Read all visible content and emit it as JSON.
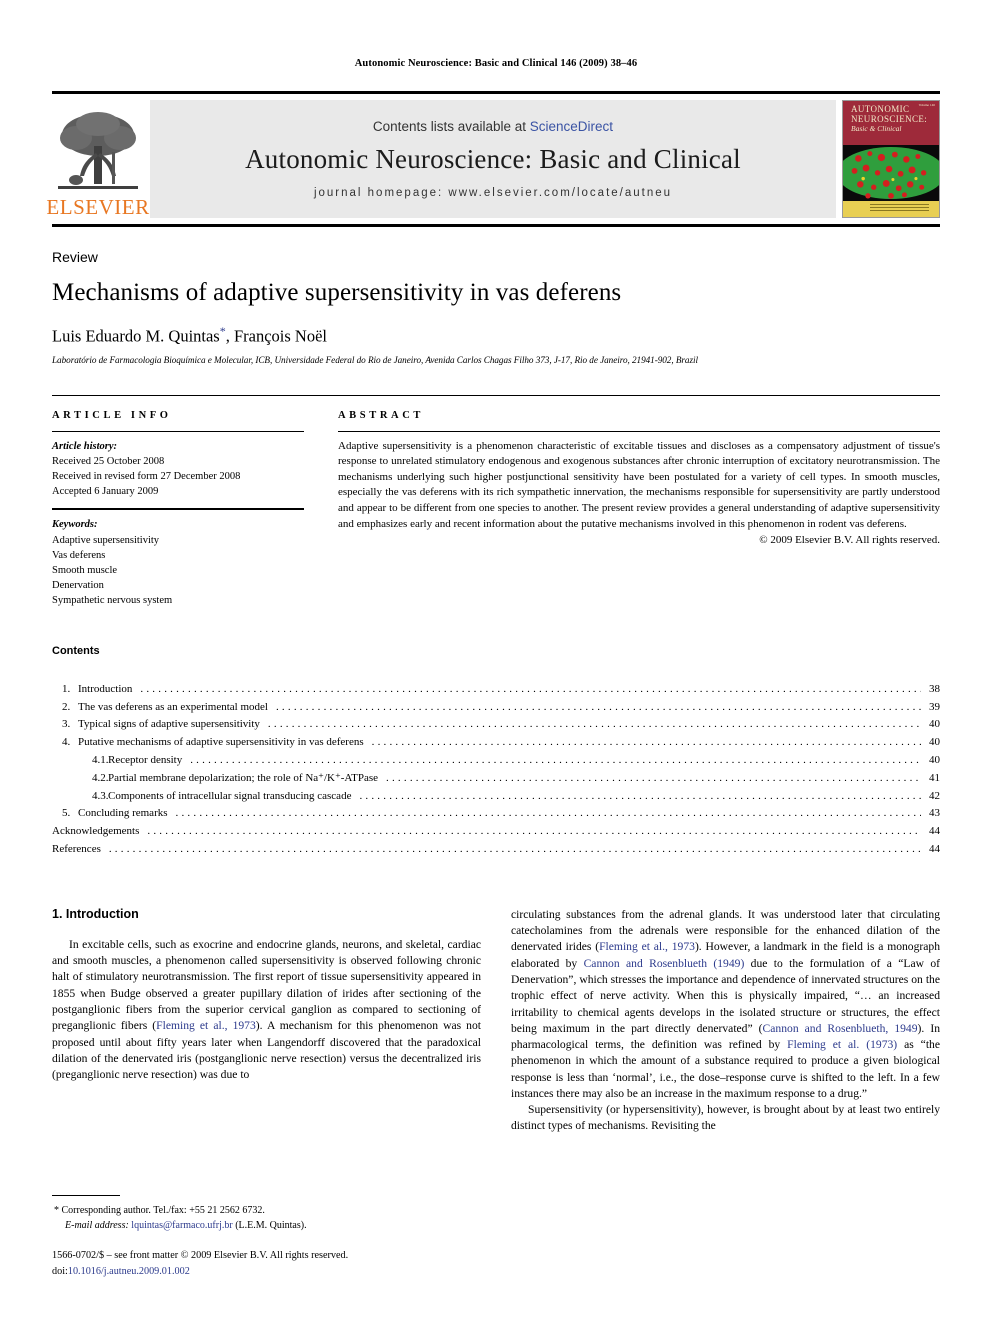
{
  "running_head": "Autonomic Neuroscience: Basic and Clinical 146 (2009) 38–46",
  "masthead": {
    "contents_available": "Contents lists available at",
    "sciencedirect": "ScienceDirect",
    "journal_title": "Autonomic Neuroscience: Basic and Clinical",
    "homepage": "journal homepage: www.elsevier.com/locate/autneu",
    "publisher": "ELSEVIER",
    "cover": {
      "line1": "AUTONOMIC",
      "line2": "NEUROSCIENCE:",
      "line3": "Basic & Clinical",
      "volume": "Volume 146"
    }
  },
  "article": {
    "type": "Review",
    "title": "Mechanisms of adaptive supersensitivity in vas deferens",
    "authors": "Luis Eduardo M. Quintas",
    "corresponding_mark": "*",
    "authors_rest": ", François Noël",
    "affiliation": "Laboratório de Farmacologia Bioquímica e Molecular, ICB, Universidade Federal do Rio de Janeiro, Avenida Carlos Chagas Filho 373, J-17, Rio de Janeiro, 21941-902, Brazil"
  },
  "article_info": {
    "heading": "ARTICLE INFO",
    "history_label": "Article history:",
    "history": [
      "Received 25 October 2008",
      "Received in revised form 27 December 2008",
      "Accepted 6 January 2009"
    ],
    "keywords_label": "Keywords:",
    "keywords": [
      "Adaptive supersensitivity",
      "Vas deferens",
      "Smooth muscle",
      "Denervation",
      "Sympathetic nervous system"
    ]
  },
  "abstract": {
    "heading": "ABSTRACT",
    "text": "Adaptive supersensitivity is a phenomenon characteristic of excitable tissues and discloses as a compensatory adjustment of tissue's response to unrelated stimulatory endogenous and exogenous substances after chronic interruption of excitatory neurotransmission. The mechanisms underlying such higher postjunctional sensitivity have been postulated for a variety of cell types. In smooth muscles, especially the vas deferens with its rich sympathetic innervation, the mechanisms responsible for supersensitivity are partly understood and appear to be different from one species to another. The present review provides a general understanding of adaptive supersensitivity and emphasizes early and recent information about the putative mechanisms involved in this phenomenon in rodent vas deferens.",
    "copyright": "© 2009 Elsevier B.V. All rights reserved."
  },
  "contents": {
    "heading": "Contents",
    "items": [
      {
        "num": "1.",
        "level": 0,
        "label": "Introduction",
        "page": "38"
      },
      {
        "num": "2.",
        "level": 0,
        "label": "The vas deferens as an experimental model",
        "page": "39"
      },
      {
        "num": "3.",
        "level": 0,
        "label": "Typical signs of adaptive supersensitivity",
        "page": "40"
      },
      {
        "num": "4.",
        "level": 0,
        "label": "Putative mechanisms of adaptive supersensitivity in vas deferens",
        "page": "40"
      },
      {
        "num": "4.1.",
        "level": 1,
        "label": "Receptor density",
        "page": "40"
      },
      {
        "num": "4.2.",
        "level": 1,
        "label": "Partial membrane depolarization; the role of Na⁺/K⁺-ATPase",
        "page": "41"
      },
      {
        "num": "4.3.",
        "level": 1,
        "label": "Components of intracellular signal transducing cascade",
        "page": "42"
      },
      {
        "num": "5.",
        "level": 0,
        "label": "Concluding remarks",
        "page": "43"
      },
      {
        "num": "",
        "level": 2,
        "label": "Acknowledgements",
        "page": "44"
      },
      {
        "num": "",
        "level": 2,
        "label": "References",
        "page": "44"
      }
    ]
  },
  "introduction": {
    "heading": "1. Introduction",
    "left_p1_a": "In excitable cells, such as exocrine and endocrine glands, neurons, and skeletal, cardiac and smooth muscles, a phenomenon called supersensitivity is observed following chronic halt of stimulatory neurotransmission. The first report of tissue supersensitivity appeared in 1855 when Budge observed a greater pupillary dilation of irides after sectioning of the postganglionic fibers from the superior cervical ganglion as compared to sectioning of preganglionic fibers (",
    "left_ref1": "Fleming et al., 1973",
    "left_p1_b": "). A mechanism for this phenomenon was not proposed until about fifty years later when Langendorff discovered that the paradoxical dilation of the denervated iris (postganglionic nerve resection) versus the decentralized iris (preganglionic nerve resection) was due to",
    "right_p1_a": "circulating substances from the adrenal glands. It was understood later that circulating catecholamines from the adrenals were responsible for the enhanced dilation of the denervated irides (",
    "right_ref1": "Fleming et al., 1973",
    "right_p1_b": "). However, a landmark in the field is a monograph elaborated by ",
    "right_ref2": "Cannon and Rosenblueth (1949)",
    "right_p1_c": " due to the formulation of a “Law of Denervation”, which stresses the importance and dependence of innervated structures on the trophic effect of nerve activity. When this is physically impaired, “… an increased irritability to chemical agents develops in the isolated structure or structures, the effect being maximum in the part directly denervated” (",
    "right_ref3": "Cannon and Rosenblueth, 1949",
    "right_p1_d": "). In pharmacological terms, the definition was refined by ",
    "right_ref4": "Fleming et al. (1973)",
    "right_p1_e": " as “the phenomenon in which the amount of a substance required to produce a given biological response is less than ‘normal’, i.e., the dose–response curve is shifted to the left. In a few instances there may also be an increase in the maximum response to a drug.”",
    "right_p2": "Supersensitivity (or hypersensitivity), however, is brought about by at least two entirely distinct types of mechanisms. Revisiting the"
  },
  "footnote": {
    "corresponding": "* Corresponding author. Tel./fax: +55 21 2562 6732.",
    "email_label": "E-mail address:",
    "email": "lquintas@farmaco.ufrj.br",
    "email_suffix": "(L.E.M. Quintas).",
    "issn": "1566-0702/$ – see front matter © 2009 Elsevier B.V. All rights reserved.",
    "doi_label": "doi:",
    "doi": "10.1016/j.autneu.2009.01.002"
  },
  "colors": {
    "link": "#2c3a8c",
    "sciencedirect": "#3a53a4",
    "elsevier_orange": "#E87722",
    "cover_red": "#9e2a3a",
    "cover_green": "#2f9e3d",
    "cover_yellow": "#e8cf53"
  }
}
